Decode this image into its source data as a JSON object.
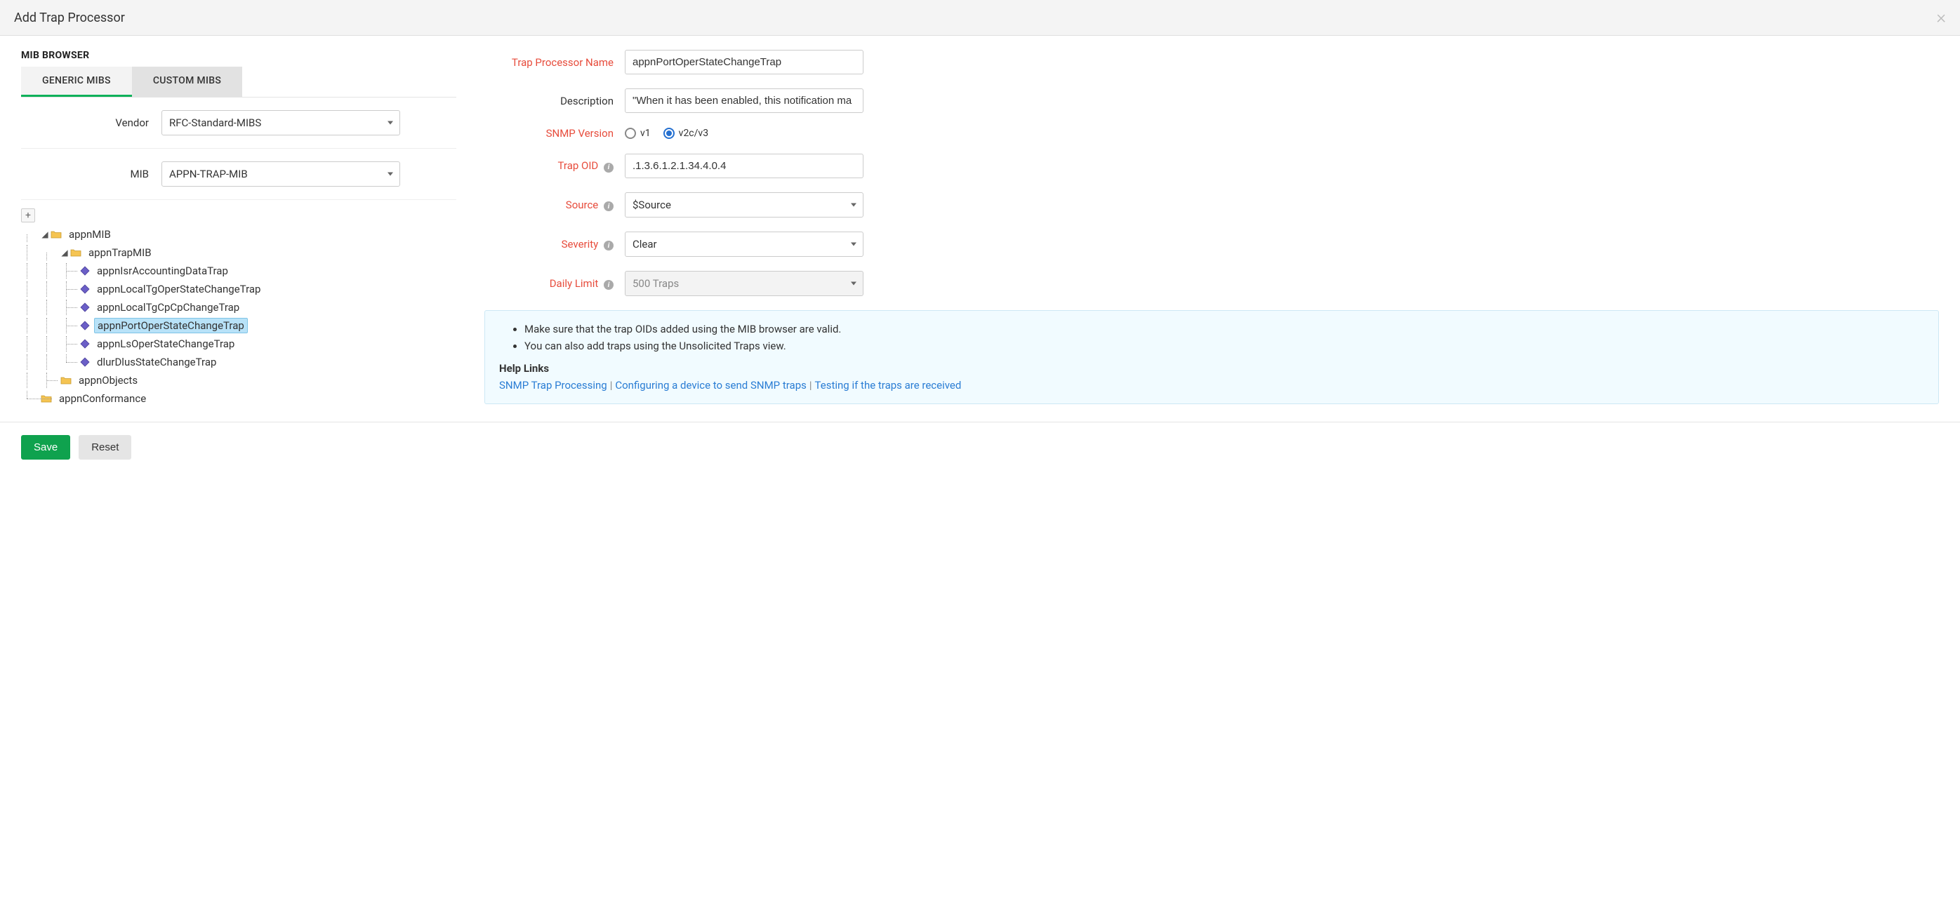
{
  "header": {
    "title": "Add Trap Processor"
  },
  "mib_browser": {
    "heading": "MIB BROWSER",
    "tabs": {
      "generic": "GENERIC MIBS",
      "custom": "CUSTOM MIBS"
    },
    "vendor_label": "Vendor",
    "vendor_value": "RFC-Standard-MIBS",
    "mib_label": "MIB",
    "mib_value": "APPN-TRAP-MIB",
    "tree": {
      "root": "appnMIB",
      "trap_mib": "appnTrapMIB",
      "leaves": {
        "l0": "appnIsrAccountingDataTrap",
        "l1": "appnLocalTgOperStateChangeTrap",
        "l2": "appnLocalTgCpCpChangeTrap",
        "l3": "appnPortOperStateChangeTrap",
        "l4": "appnLsOperStateChangeTrap",
        "l5": "dlurDlusStateChangeTrap"
      },
      "objects": "appnObjects",
      "conformance": "appnConformance"
    }
  },
  "form": {
    "name_label": "Trap Processor Name",
    "name_value": "appnPortOperStateChangeTrap",
    "desc_label": "Description",
    "desc_value": "\"When it has been enabled, this notification ma",
    "snmp_label": "SNMP Version",
    "snmp_v1": "v1",
    "snmp_v2": "v2c/v3",
    "oid_label": "Trap OID",
    "oid_value": ".1.3.6.1.2.1.34.4.0.4",
    "source_label": "Source",
    "source_value": "$Source",
    "severity_label": "Severity",
    "severity_value": "Clear",
    "limit_label": "Daily Limit",
    "limit_value": "500 Traps"
  },
  "info": {
    "bullet1": "Make sure that the trap OIDs added using the MIB browser are valid.",
    "bullet2": "You can also add traps using the Unsolicited Traps view.",
    "help_heading": "Help Links",
    "link1": "SNMP Trap Processing",
    "link2": "Configuring a device to send SNMP traps",
    "link3": "Testing if the traps are received"
  },
  "footer": {
    "save": "Save",
    "reset": "Reset"
  }
}
